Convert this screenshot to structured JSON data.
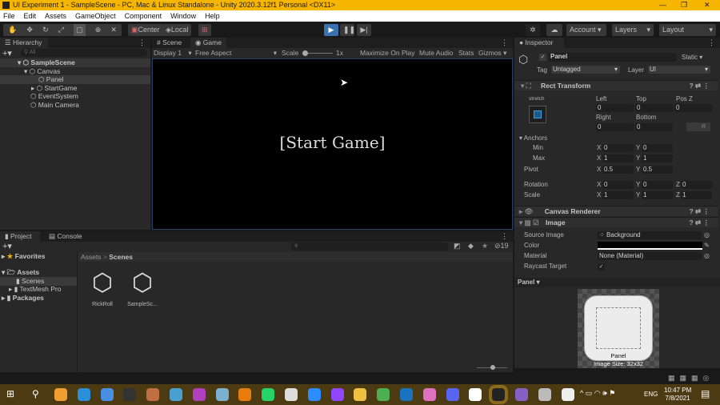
{
  "window": {
    "title": "UI Experiment 1 - SampleScene - PC, Mac & Linux Standalone - Unity 2020.3.12f1 Personal <DX11>"
  },
  "menu": [
    "File",
    "Edit",
    "Assets",
    "GameObject",
    "Component",
    "Window",
    "Help"
  ],
  "toolbar": {
    "center": "Center",
    "local": "Local",
    "account": "Account",
    "layers": "Layers",
    "layout": "Layout"
  },
  "hierarchy": {
    "tab": "Hierarchy",
    "search_placeholder": "All",
    "items": [
      {
        "label": "SampleScene"
      },
      {
        "label": "Canvas"
      },
      {
        "label": "Panel"
      },
      {
        "label": "StartGame"
      },
      {
        "label": "EventSystem"
      },
      {
        "label": "Main Camera"
      }
    ]
  },
  "game": {
    "tabs": [
      "Scene",
      "Game"
    ],
    "display": "Display 1",
    "aspect": "Free Aspect",
    "scale_label": "Scale",
    "scale_value": "1x",
    "maximize": "Maximize On Play",
    "mute": "Mute Audio",
    "stats": "Stats",
    "gizmos": "Gizmos",
    "canvas_text": "[Start Game]"
  },
  "inspector": {
    "tab": "Inspector",
    "object_name": "Panel",
    "static": "Static",
    "tag_label": "Tag",
    "tag": "Untagged",
    "layer_label": "Layer",
    "layer": "UI",
    "rect": {
      "title": "Rect Transform",
      "stretch": "stretch",
      "left_l": "Left",
      "top_l": "Top",
      "posz_l": "Pos Z",
      "left": "0",
      "top": "0",
      "posz": "0",
      "right_l": "Right",
      "bottom_l": "Bottom",
      "right": "0",
      "bottom": "0",
      "r": "R",
      "anchors": "Anchors",
      "min": "Min",
      "max": "Max",
      "pivot": "Pivot",
      "rotation": "Rotation",
      "scale": "Scale",
      "min_x": "0",
      "min_y": "0",
      "max_x": "1",
      "max_y": "1",
      "pivot_x": "0.5",
      "pivot_y": "0.5",
      "rot_x": "0",
      "rot_y": "0",
      "rot_z": "0",
      "scale_x": "1",
      "scale_y": "1",
      "scale_z": "1"
    },
    "canvas_renderer": "Canvas Renderer",
    "image": {
      "title": "Image",
      "source_l": "Source Image",
      "source": "Background",
      "color_l": "Color",
      "material_l": "Material",
      "material": "None (Material)",
      "raycast_l": "Raycast Target",
      "color": "#000000"
    },
    "preview": {
      "title": "Panel",
      "name": "Panel",
      "size": "Image Size: 32x32"
    }
  },
  "project": {
    "tabs": [
      "Project",
      "Console"
    ],
    "favorites": "Favorites",
    "assets": "Assets",
    "scenes": "Scenes",
    "textmesh": "TextMesh Pro",
    "packages": "Packages",
    "breadcrumb": [
      "Assets",
      "Scenes"
    ],
    "files": [
      "RickRoll",
      "SampleSc..."
    ],
    "hidden_count": "19"
  },
  "taskbar": {
    "time": "10:47 PM",
    "date": "7/8/2021",
    "lang": "ENG",
    "apps": [
      {
        "name": "app1",
        "color": "#f0a030"
      },
      {
        "name": "musescore",
        "color": "#2a8ed8"
      },
      {
        "name": "app3",
        "color": "#4a90e2"
      },
      {
        "name": "obs",
        "color": "#333"
      },
      {
        "name": "app5",
        "color": "#c07040"
      },
      {
        "name": "krita",
        "color": "#4aa0d0"
      },
      {
        "name": "affinity-photo",
        "color": "#b040c0"
      },
      {
        "name": "app8",
        "color": "#7ab0d0"
      },
      {
        "name": "blender",
        "color": "#e87d0d"
      },
      {
        "name": "whatsapp",
        "color": "#25d366"
      },
      {
        "name": "camera",
        "color": "#ddd"
      },
      {
        "name": "zoom",
        "color": "#2d8cff"
      },
      {
        "name": "twitch",
        "color": "#9146ff"
      },
      {
        "name": "file-explorer",
        "color": "#f0c040"
      },
      {
        "name": "chrome",
        "color": "#4caf50"
      },
      {
        "name": "affinity-designer",
        "color": "#1b72be"
      },
      {
        "name": "app17",
        "color": "#e070c0"
      },
      {
        "name": "discord",
        "color": "#5865f2"
      },
      {
        "name": "app19",
        "color": "#fff"
      },
      {
        "name": "unity",
        "color": "#222"
      },
      {
        "name": "visual-studio",
        "color": "#8661c5"
      },
      {
        "name": "app22",
        "color": "#bbb"
      },
      {
        "name": "settings",
        "color": "#eee"
      }
    ]
  }
}
